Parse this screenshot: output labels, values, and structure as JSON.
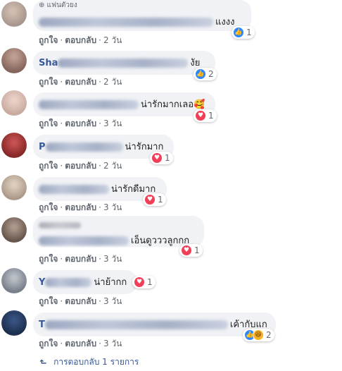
{
  "colors": {
    "bubble_bg": "#f0f2f5",
    "name": "#385898",
    "meta": "#606770",
    "like": "#2d88ff",
    "love": "#f33e58"
  },
  "actions": {
    "like": "ถูกใจ",
    "reply": "ตอบกลับ",
    "sep": "·"
  },
  "comments": [
    {
      "label": "⊕ แฟนตัวยง",
      "text": "แงงง",
      "time": "2 วัน",
      "reactions": [
        "like"
      ],
      "count": "1"
    },
    {
      "name_prefix": "Sha",
      "text": "งัย",
      "time": "2 วัน",
      "reactions": [
        "like"
      ],
      "count": "2"
    },
    {
      "text": "น่ารักมากเลอ🥰",
      "time": "3 วัน",
      "reactions": [
        "love"
      ],
      "count": "1"
    },
    {
      "name_prefix": "P",
      "text": "น่ารักมาก",
      "time": "2 วัน",
      "reactions": [
        "love"
      ],
      "count": "1"
    },
    {
      "text": "น่ารักดีมาก",
      "time": "3 วัน",
      "reactions": [
        "love"
      ],
      "count": "1"
    },
    {
      "text": "เอ็นดูวววลูกกก",
      "time": "3 วัน",
      "reactions": [
        "love"
      ],
      "count": "1"
    },
    {
      "name_prefix": "Y",
      "text": "น่าย้ากก",
      "time": "3 วัน",
      "reactions": [
        "love"
      ],
      "count": "1"
    },
    {
      "name_prefix": "T",
      "text": "เค้ากับแก",
      "time": "3 วัน",
      "reactions": [
        "like",
        "haha"
      ],
      "count": "2"
    }
  ],
  "more_replies": {
    "arrow": "↳",
    "label": "การตอบกลับ 1 รายการ"
  },
  "icons": {
    "like": "thumbs-up-icon",
    "love": "heart-icon",
    "haha": "laughing-face-icon"
  }
}
